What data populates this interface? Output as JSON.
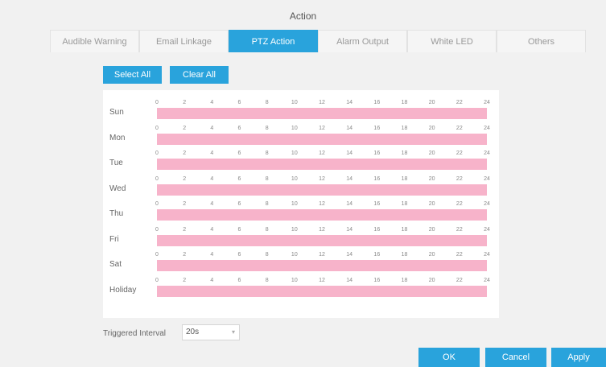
{
  "title": "Action",
  "tabs": [
    {
      "label": "Audible Warning",
      "active": false
    },
    {
      "label": "Email Linkage",
      "active": false
    },
    {
      "label": "PTZ Action",
      "active": true
    },
    {
      "label": "Alarm Output",
      "active": false
    },
    {
      "label": "White LED",
      "active": false
    },
    {
      "label": "Others",
      "active": false
    }
  ],
  "buttons": {
    "select_all": "Select All",
    "clear_all": "Clear All",
    "ok": "OK",
    "cancel": "Cancel",
    "apply": "Apply"
  },
  "schedule": {
    "hour_ticks": [
      "0",
      "2",
      "4",
      "6",
      "8",
      "10",
      "12",
      "14",
      "16",
      "18",
      "20",
      "22",
      "24"
    ],
    "days": [
      {
        "label": "Sun",
        "selected_fraction": 1
      },
      {
        "label": "Mon",
        "selected_fraction": 1
      },
      {
        "label": "Tue",
        "selected_fraction": 1
      },
      {
        "label": "Wed",
        "selected_fraction": 1
      },
      {
        "label": "Thu",
        "selected_fraction": 1
      },
      {
        "label": "Fri",
        "selected_fraction": 1
      },
      {
        "label": "Sat",
        "selected_fraction": 1
      },
      {
        "label": "Holiday",
        "selected_fraction": 1
      }
    ],
    "selected_color": "#f7b3ca"
  },
  "triggered_interval": {
    "label": "Triggered Interval",
    "value": "20s"
  },
  "colors": {
    "accent": "#29a3dc"
  }
}
